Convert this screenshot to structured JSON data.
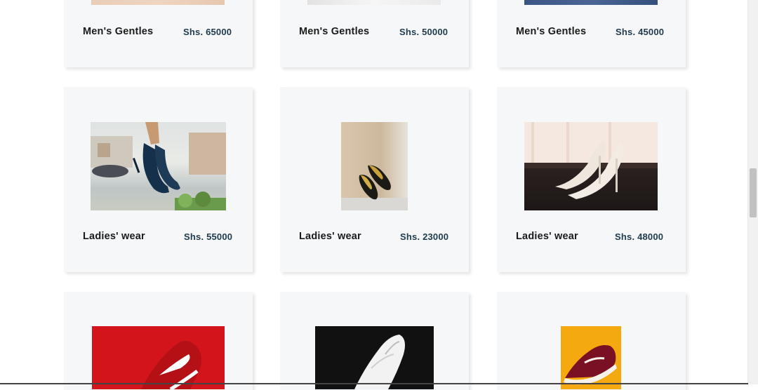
{
  "products": [
    {
      "name": "Men's Gentles",
      "price": "Shs. 65000",
      "image": "mens-shoe-tan"
    },
    {
      "name": "Men's Gentles",
      "price": "Shs. 50000",
      "image": "mens-shoe-white"
    },
    {
      "name": "Men's Gentles",
      "price": "Shs. 45000",
      "image": "mens-shoe-navy"
    },
    {
      "name": "Ladies' wear",
      "price": "Shs. 55000",
      "image": "navy-heels-held"
    },
    {
      "name": "Ladies' wear",
      "price": "Shs. 23000",
      "image": "gold-flats"
    },
    {
      "name": "Ladies' wear",
      "price": "Shs. 48000",
      "image": "white-heels"
    },
    {
      "name": "",
      "price": "",
      "image": "red-running-shoe"
    },
    {
      "name": "",
      "price": "",
      "image": "white-sneaker-black-bg"
    },
    {
      "name": "",
      "price": "",
      "image": "maroon-sneaker-yellow-bg"
    }
  ],
  "colors": {
    "card_bg": "#f5f7f9",
    "price": "#1f3b4d",
    "name": "#1b1b1b"
  }
}
